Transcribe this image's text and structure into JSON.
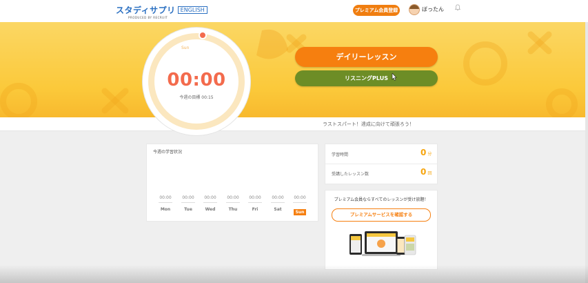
{
  "header": {
    "logo_text": "スタディサプリ",
    "logo_badge": "ENGLISH",
    "logo_sub": "PRODUCED BY RECRUIT",
    "premium_button": "プレミアム会員登録",
    "username": "ぼったん"
  },
  "hero": {
    "sun_label": "Sun",
    "timer": "00:00",
    "goal": "今週の目標 00:15",
    "daily_button": "デイリーレッスン",
    "listening_button": "リスニングPLUS",
    "motivation": "ラストスパート！達成に向けて頑張ろう！"
  },
  "weekly": {
    "title": "今週の学習状況",
    "days": [
      {
        "name": "Mon",
        "time": "00:00"
      },
      {
        "name": "Tue",
        "time": "00:00"
      },
      {
        "name": "Wed",
        "time": "00:00"
      },
      {
        "name": "Thu",
        "time": "00:00"
      },
      {
        "name": "Fri",
        "time": "00:00"
      },
      {
        "name": "Sat",
        "time": "00:00"
      },
      {
        "name": "Sun",
        "time": "00:00"
      }
    ],
    "today": "Sun"
  },
  "stats": {
    "study_time_label": "学習時間",
    "study_time_value": "0",
    "study_time_unit": "分",
    "lessons_label": "受講したレッスン数",
    "lessons_value": "0",
    "lessons_unit": "回"
  },
  "promo": {
    "text": "プレミアム会員ならすべてのレッスンが受け放題！",
    "button": "プレミアムサービスを確認する"
  },
  "colors": {
    "accent_orange": "#f67f0f",
    "listening_green": "#6d8d26",
    "timer_red": "#f36b4d",
    "hero_yellow": "#fbc93a"
  }
}
